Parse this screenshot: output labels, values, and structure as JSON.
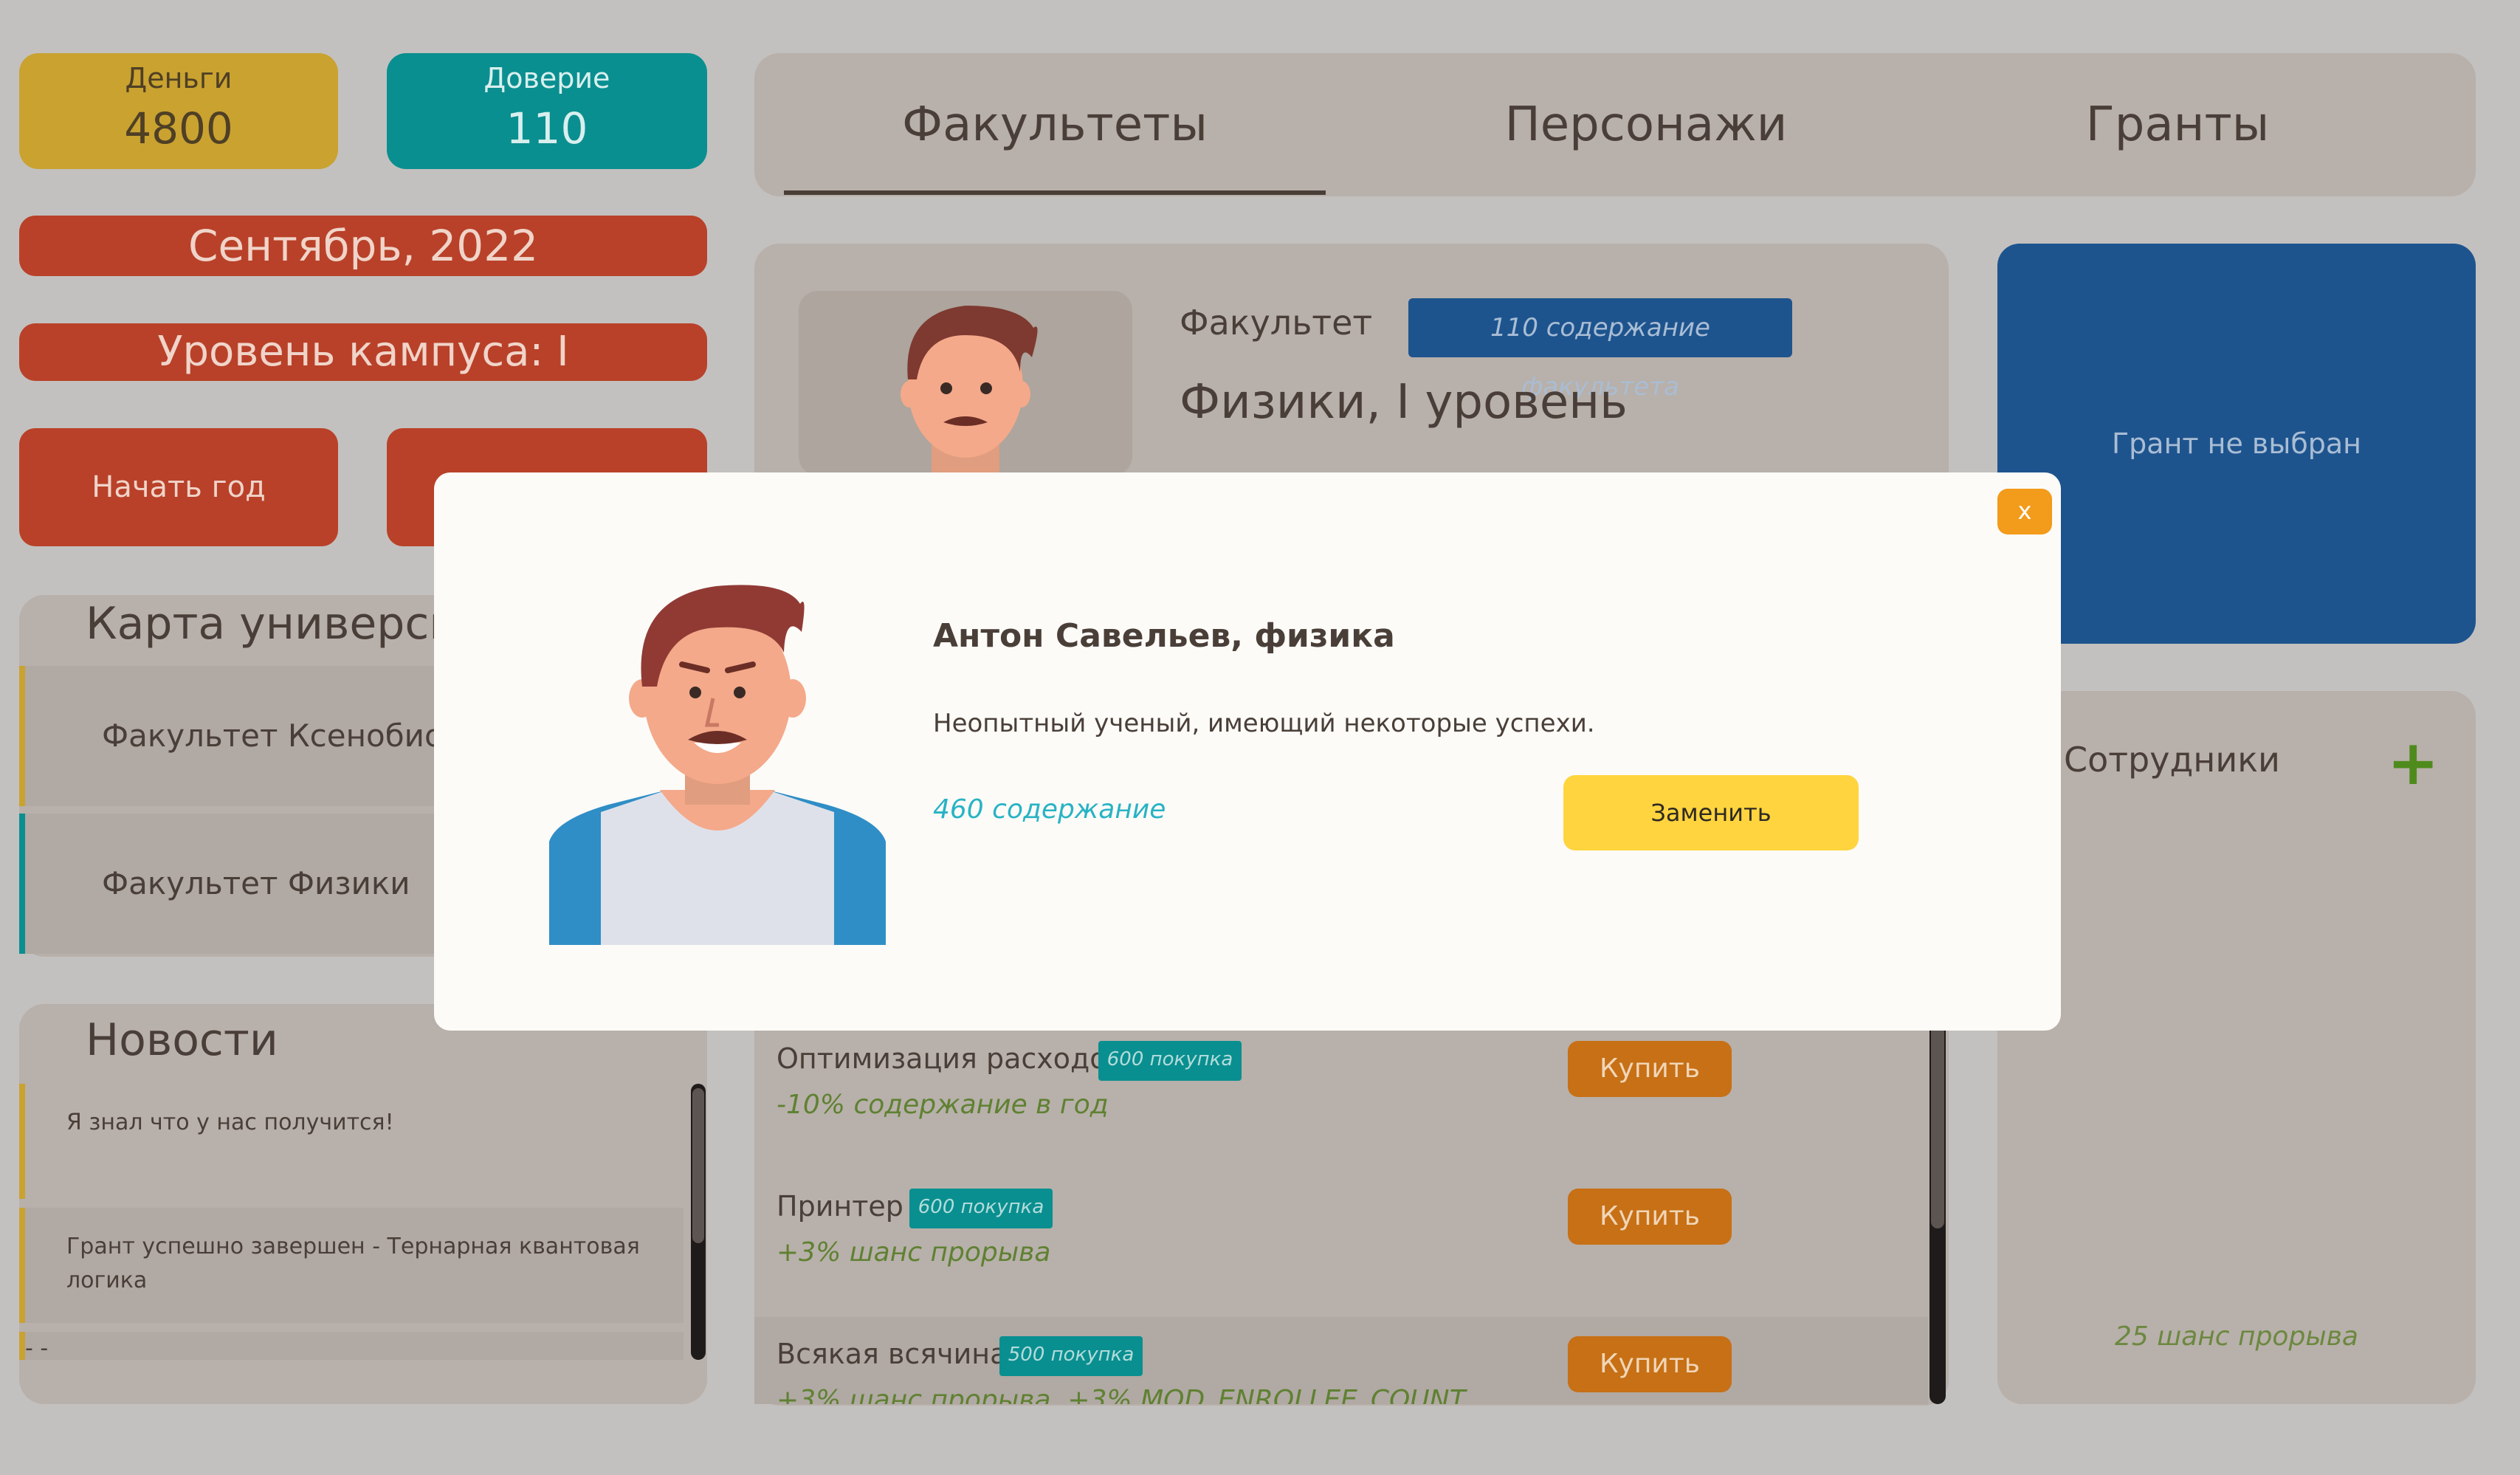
{
  "stats": {
    "money": {
      "label": "Деньги",
      "value": "4800"
    },
    "trust": {
      "label": "Доверие",
      "value": "110"
    }
  },
  "date": "Сентябрь, 2022",
  "campus_level": "Уровень кампуса: I",
  "actions": {
    "start_year": "Начать год"
  },
  "map": {
    "title": "Карта университ",
    "items": [
      {
        "label": "Факультет Ксенобиол"
      },
      {
        "label": "Факультет Физики"
      }
    ]
  },
  "news": {
    "title": "Новости",
    "items": [
      {
        "text": "Я знал что у нас получится!"
      },
      {
        "text": "Грант успешно завершен - Тернарная квантовая логика"
      },
      {
        "text": "-              -"
      }
    ]
  },
  "tabs": [
    {
      "label": "Факультеты"
    },
    {
      "label": "Персонажи"
    },
    {
      "label": "Гранты"
    }
  ],
  "faculty": {
    "label": "Факультет",
    "upkeep_badge": "110 содержание факультета",
    "name": "Физики, I уровень"
  },
  "upgrades": [
    {
      "name": "Оптимизация расходов",
      "badge": "600 покупка",
      "effect": "-10% содержание в год",
      "buy_label": "Купить"
    },
    {
      "name": "Принтер",
      "badge": "600 покупка",
      "effect": "+3% шанс прорыва",
      "buy_label": "Купить"
    },
    {
      "name": "Всякая всячина",
      "badge": "500 покупка",
      "effect": "+3% шанс прорыва, +3% MOD_ENROLLEE_COUNT",
      "buy_label": "Купить"
    }
  ],
  "grant": {
    "status": "Грант не выбран"
  },
  "staff": {
    "title": "Сотрудники",
    "add_icon": "+",
    "chance": "25 шанс прорыва"
  },
  "modal": {
    "close_label": "x",
    "name": "Антон Савельев, физика",
    "description": "Неопытный ученый, имеющий некоторые успехи.",
    "cost": "460 содержание",
    "replace_label": "Заменить"
  },
  "colors": {
    "money": "#c9a230",
    "trust": "#0a8f90",
    "primary_red": "#b94129",
    "grant_blue": "#1e548e",
    "buy_orange": "#c77016",
    "modal_button": "#ffd43e",
    "modal_close": "#f39b1a"
  }
}
